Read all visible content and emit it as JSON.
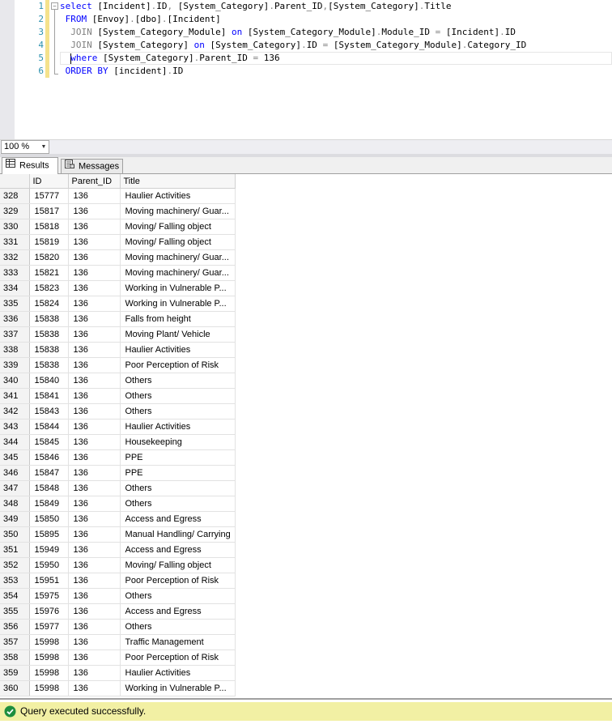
{
  "editor": {
    "line_numbers": [
      "1",
      "2",
      "3",
      "4",
      "5",
      "6"
    ],
    "lines": [
      [
        {
          "t": "select ",
          "c": "kw"
        },
        {
          "t": "[Incident]"
        },
        {
          "t": ".",
          "c": "op"
        },
        {
          "t": "ID"
        },
        {
          "t": ", ",
          "c": "op"
        },
        {
          "t": "[System_Category]"
        },
        {
          "t": ".",
          "c": "op"
        },
        {
          "t": "Parent_ID"
        },
        {
          "t": ",",
          "c": "op"
        },
        {
          "t": "[System_Category]"
        },
        {
          "t": ".",
          "c": "op"
        },
        {
          "t": "Title"
        }
      ],
      [
        {
          "t": " "
        },
        {
          "t": "FROM ",
          "c": "kw"
        },
        {
          "t": "[Envoy]"
        },
        {
          "t": ".",
          "c": "op"
        },
        {
          "t": "[dbo]"
        },
        {
          "t": ".",
          "c": "op"
        },
        {
          "t": "[Incident]"
        }
      ],
      [
        {
          "t": "  "
        },
        {
          "t": "JOIN ",
          "c": "op"
        },
        {
          "t": "[System_Category_Module] "
        },
        {
          "t": "on ",
          "c": "kw"
        },
        {
          "t": "[System_Category_Module]"
        },
        {
          "t": ".",
          "c": "op"
        },
        {
          "t": "Module_ID "
        },
        {
          "t": "= ",
          "c": "op"
        },
        {
          "t": "[Incident]"
        },
        {
          "t": ".",
          "c": "op"
        },
        {
          "t": "ID"
        }
      ],
      [
        {
          "t": "  "
        },
        {
          "t": "JOIN ",
          "c": "op"
        },
        {
          "t": "[System_Category] "
        },
        {
          "t": "on ",
          "c": "kw"
        },
        {
          "t": "[System_Category]"
        },
        {
          "t": ".",
          "c": "op"
        },
        {
          "t": "ID "
        },
        {
          "t": "= ",
          "c": "op"
        },
        {
          "t": "[System_Category_Module]"
        },
        {
          "t": ".",
          "c": "op"
        },
        {
          "t": "Category_ID"
        }
      ],
      [
        {
          "t": "  ",
          "caret": true
        },
        {
          "t": "where ",
          "c": "kw"
        },
        {
          "t": "[System_Category]"
        },
        {
          "t": ".",
          "c": "op"
        },
        {
          "t": "Parent_ID "
        },
        {
          "t": "= ",
          "c": "op"
        },
        {
          "t": "136"
        }
      ],
      [
        {
          "t": " "
        },
        {
          "t": "ORDER BY ",
          "c": "kw"
        },
        {
          "t": "[incident]"
        },
        {
          "t": ".",
          "c": "op"
        },
        {
          "t": "ID"
        }
      ]
    ]
  },
  "zoom": {
    "value": "100 %"
  },
  "tabs": {
    "results": "Results",
    "messages": "Messages"
  },
  "grid": {
    "columns": [
      "",
      "ID",
      "Parent_ID",
      "Title"
    ],
    "rows": [
      [
        "328",
        "15777",
        "136",
        "Haulier Activities"
      ],
      [
        "329",
        "15817",
        "136",
        "Moving machinery/ Guar..."
      ],
      [
        "330",
        "15818",
        "136",
        "Moving/ Falling object"
      ],
      [
        "331",
        "15819",
        "136",
        "Moving/ Falling object"
      ],
      [
        "332",
        "15820",
        "136",
        "Moving machinery/ Guar..."
      ],
      [
        "333",
        "15821",
        "136",
        "Moving machinery/ Guar..."
      ],
      [
        "334",
        "15823",
        "136",
        "Working in Vulnerable P..."
      ],
      [
        "335",
        "15824",
        "136",
        "Working in Vulnerable P..."
      ],
      [
        "336",
        "15838",
        "136",
        "Falls from height"
      ],
      [
        "337",
        "15838",
        "136",
        "Moving Plant/ Vehicle"
      ],
      [
        "338",
        "15838",
        "136",
        "Haulier Activities"
      ],
      [
        "339",
        "15838",
        "136",
        "Poor Perception of Risk"
      ],
      [
        "340",
        "15840",
        "136",
        "Others"
      ],
      [
        "341",
        "15841",
        "136",
        "Others"
      ],
      [
        "342",
        "15843",
        "136",
        "Others"
      ],
      [
        "343",
        "15844",
        "136",
        "Haulier Activities"
      ],
      [
        "344",
        "15845",
        "136",
        "Housekeeping"
      ],
      [
        "345",
        "15846",
        "136",
        "PPE"
      ],
      [
        "346",
        "15847",
        "136",
        "PPE"
      ],
      [
        "347",
        "15848",
        "136",
        "Others"
      ],
      [
        "348",
        "15849",
        "136",
        "Others"
      ],
      [
        "349",
        "15850",
        "136",
        "Access and Egress"
      ],
      [
        "350",
        "15895",
        "136",
        "Manual Handling/ Carrying"
      ],
      [
        "351",
        "15949",
        "136",
        "Access and Egress"
      ],
      [
        "352",
        "15950",
        "136",
        "Moving/ Falling object"
      ],
      [
        "353",
        "15951",
        "136",
        "Poor Perception of Risk"
      ],
      [
        "354",
        "15975",
        "136",
        "Others"
      ],
      [
        "355",
        "15976",
        "136",
        "Access and Egress"
      ],
      [
        "356",
        "15977",
        "136",
        "Others"
      ],
      [
        "357",
        "15998",
        "136",
        "Traffic Management"
      ],
      [
        "358",
        "15998",
        "136",
        "Poor Perception of Risk"
      ],
      [
        "359",
        "15998",
        "136",
        "Haulier Activities"
      ],
      [
        "360",
        "15998",
        "136",
        "Working in Vulnerable P..."
      ]
    ]
  },
  "status": {
    "text": "Query executed successfully.",
    "color": "#f2f0a4"
  }
}
